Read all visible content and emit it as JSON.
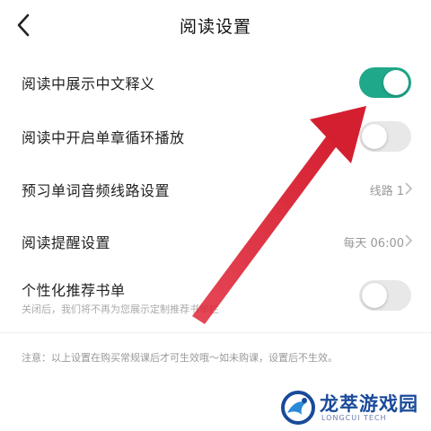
{
  "header": {
    "title": "阅读设置",
    "back_icon": "chevron-left-icon"
  },
  "settings": [
    {
      "label": "阅读中展示中文释义",
      "type": "toggle",
      "on": true
    },
    {
      "label": "阅读中开启单章循环播放",
      "type": "toggle",
      "on": false
    },
    {
      "label": "预习单词音频线路设置",
      "type": "select",
      "value": "线路 1"
    },
    {
      "label": "阅读提醒设置",
      "type": "select",
      "value": "每天 06:00"
    },
    {
      "label": "个性化推荐书单",
      "type": "toggle",
      "on": false,
      "subtitle": "关闭后，我们将不再为您展示定制推荐书单栏"
    }
  ],
  "note": "注意：以上设置在购买常规课后才可生效哦～如未购课，设置后不生效。",
  "colors": {
    "toggle_on": "#1fa88a",
    "toggle_off": "#e8e8e8",
    "arrow": "#e0283a"
  },
  "watermark": {
    "name": "龙萃游戏园",
    "sub": "LONGCUI TECH"
  }
}
